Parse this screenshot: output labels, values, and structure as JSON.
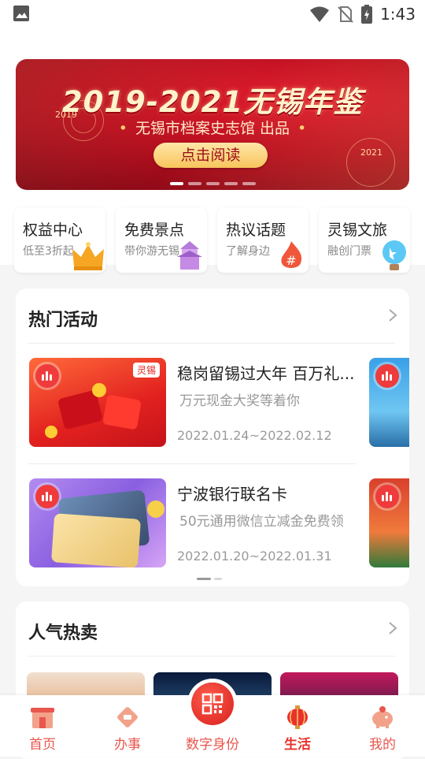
{
  "status_bar": {
    "time": "1:43",
    "icons": [
      "image-icon",
      "wifi-icon",
      "no-sim-icon",
      "battery-charging-icon"
    ]
  },
  "banner": {
    "title": "2019-2021无锡年鉴",
    "subtitle": "无锡市档案史志馆 出品",
    "button_label": "点击阅读",
    "year_left": "2019",
    "year_right": "2021",
    "page_count": 5
  },
  "quick_entries": [
    {
      "title": "权益中心",
      "subtitle": "低至3折起",
      "icon": "crown-icon"
    },
    {
      "title": "免费景点",
      "subtitle": "带你游无锡",
      "icon": "temple-icon"
    },
    {
      "title": "热议话题",
      "subtitle": "了解身边",
      "icon": "hashtag-flame-icon"
    },
    {
      "title": "灵锡文旅",
      "subtitle": "融创门票",
      "icon": "balloon-icon"
    }
  ],
  "hot_activities": {
    "title": "热门活动",
    "items": [
      {
        "title": "稳岗留锡过大年 百万礼...",
        "description": "万元现金大奖等着你",
        "date": "2022.01.24~2022.02.12",
        "thumb_label": "灵锡"
      },
      {
        "title": "宁波银行联名卡",
        "description": "50元通用微信立减金免费领",
        "date": "2022.01.20~2022.01.31"
      }
    ]
  },
  "popular": {
    "title": "人气热卖"
  },
  "tabbar": {
    "items": [
      {
        "label": "首页",
        "icon": "home-gate-icon"
      },
      {
        "label": "办事",
        "icon": "service-diamond-icon"
      },
      {
        "label": "数字身份",
        "icon": "qr-code-icon"
      },
      {
        "label": "生活",
        "icon": "lantern-icon"
      },
      {
        "label": "我的",
        "icon": "piggy-bank-icon"
      }
    ],
    "active": "生活"
  },
  "colors": {
    "accent": "#e8564d",
    "banner_red": "#b90e1f",
    "text_gray": "#999999"
  }
}
